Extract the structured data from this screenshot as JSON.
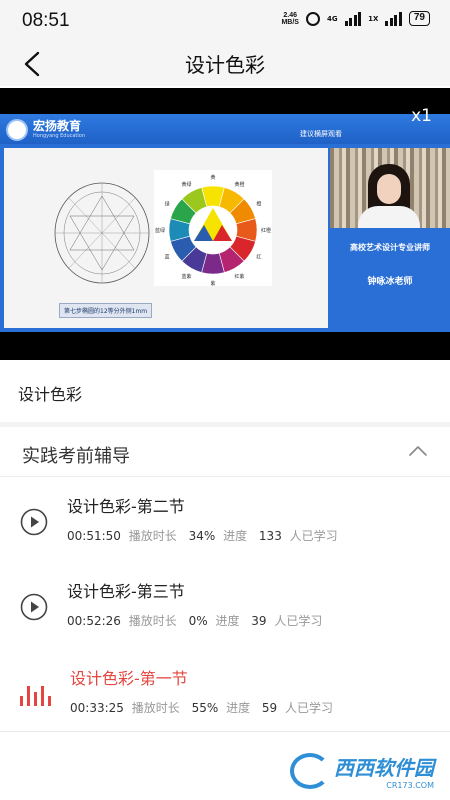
{
  "status_bar": {
    "time": "08:51",
    "net_speed_value": "2.46",
    "net_speed_unit": "MB/S",
    "network_label_1": "4G",
    "network_label_2": "1X",
    "battery": "79"
  },
  "nav": {
    "title": "设计色彩"
  },
  "video": {
    "speed": "x1",
    "slide_logo_text": "宏扬教育",
    "slide_logo_sub": "Hongyang Education",
    "slide_hint": "建议横屏观看",
    "sketch_caption": "第七步椭圆的12等分外侧1mm",
    "teacher_title": "高校艺术设计专业讲师",
    "teacher_name": "钟咏冰老师",
    "wheel_labels": [
      "黄",
      "黄橙",
      "橙",
      "红橙",
      "红",
      "红紫",
      "紫",
      "蓝紫",
      "蓝",
      "蓝绿",
      "绿",
      "黄绿"
    ]
  },
  "course": {
    "title": "设计色彩"
  },
  "chapter": {
    "title": "实践考前辅导",
    "expanded": true
  },
  "lessons": [
    {
      "title": "设计色彩-第二节",
      "duration": "00:51:50",
      "duration_label": "播放时长",
      "progress": "34%",
      "progress_label": "进度",
      "learners": "133",
      "learners_label": "人已学习",
      "active": false
    },
    {
      "title": "设计色彩-第三节",
      "duration": "00:52:26",
      "duration_label": "播放时长",
      "progress": "0%",
      "progress_label": "进度",
      "learners": "39",
      "learners_label": "人已学习",
      "active": false
    },
    {
      "title": "设计色彩-第一节",
      "duration": "00:33:25",
      "duration_label": "播放时长",
      "progress": "55%",
      "progress_label": "进度",
      "learners": "59",
      "learners_label": "人已学习",
      "active": true
    }
  ],
  "watermark": {
    "text": "西西软件园",
    "sub": "CR173.COM"
  },
  "colors": {
    "accent": "#e4473f",
    "slide_blue": "#2a6fd6",
    "watermark_blue": "#2e8fd6"
  }
}
